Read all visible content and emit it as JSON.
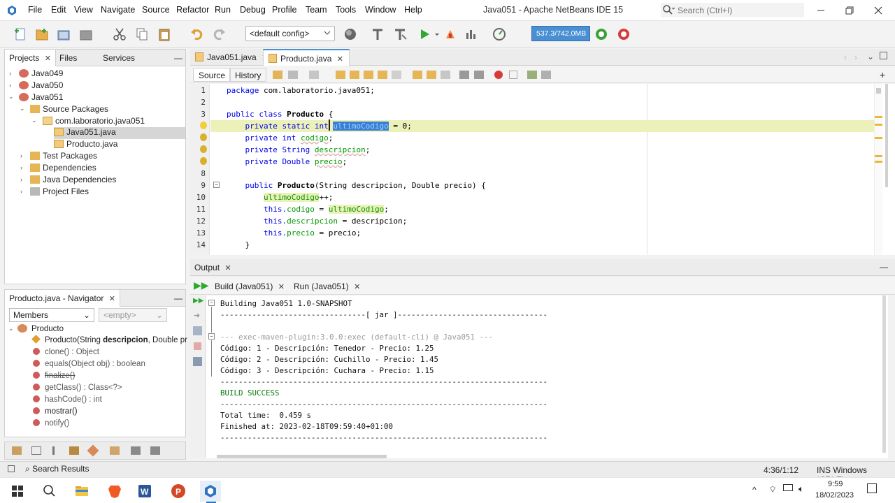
{
  "window": {
    "title": "Java051 - Apache NetBeans IDE 15",
    "search_placeholder": "Search (Ctrl+I)"
  },
  "menu": [
    "File",
    "Edit",
    "View",
    "Navigate",
    "Source",
    "Refactor",
    "Run",
    "Debug",
    "Profile",
    "Team",
    "Tools",
    "Window",
    "Help"
  ],
  "toolbar": {
    "config": "<default config>",
    "memory": "537.3/742.0MB"
  },
  "projects_panel": {
    "tabs": [
      "Projects",
      "Files",
      "Services"
    ],
    "tree": [
      {
        "label": "Java049",
        "level": 0
      },
      {
        "label": "Java050",
        "level": 0
      },
      {
        "label": "Java051",
        "level": 0
      },
      {
        "label": "Source Packages",
        "level": 1
      },
      {
        "label": "com.laboratorio.java051",
        "level": 2
      },
      {
        "label": "Java051.java",
        "level": 3
      },
      {
        "label": "Producto.java",
        "level": 3
      },
      {
        "label": "Test Packages",
        "level": 1
      },
      {
        "label": "Dependencies",
        "level": 1
      },
      {
        "label": "Java Dependencies",
        "level": 1
      },
      {
        "label": "Project Files",
        "level": 1
      }
    ]
  },
  "navigator": {
    "title": "Producto.java - Navigator",
    "filter": "Members",
    "empty": "<empty>",
    "class_name": "Producto",
    "members": [
      {
        "label": "Producto(String ",
        "bold": "descripcion",
        "rest": ", Double pr"
      },
      {
        "label": "clone() : Object",
        "bold": "",
        "rest": ""
      },
      {
        "label": "equals(Object obj) : boolean",
        "bold": "",
        "rest": ""
      },
      {
        "label": "finalize()",
        "bold": "",
        "rest": ""
      },
      {
        "label": "getClass() : Class<?>",
        "bold": "",
        "rest": ""
      },
      {
        "label": "hashCode() : int",
        "bold": "",
        "rest": ""
      },
      {
        "label": "mostrar()",
        "bold": "",
        "rest": ""
      },
      {
        "label": "notify()",
        "bold": "",
        "rest": ""
      }
    ]
  },
  "editor": {
    "tabs": [
      "Java051.java",
      "Producto.java"
    ],
    "subtabs": [
      "Source",
      "History"
    ],
    "line_numbers": [
      "1",
      "2",
      "3",
      "4",
      "5",
      "6",
      "7",
      "8",
      "9",
      "10",
      "11",
      "12",
      "13",
      "14"
    ],
    "code": {
      "l1": "package com.laboratorio.java051;",
      "l3a": "public class ",
      "l3b": "Producto",
      "l3c": " {",
      "l4a": "    private static int ",
      "l4b": "ultimoCodigo",
      "l4c": " = 0;",
      "l5a": "    private int ",
      "l5b": "codigo",
      "l5c": ";",
      "l6a": "    private String ",
      "l6b": "descripcion",
      "l6c": ";",
      "l7a": "    private Double ",
      "l7b": "precio",
      "l7c": ";",
      "l9a": "    public ",
      "l9b": "Producto",
      "l9c": "(String descripcion, Double precio) {",
      "l10a": "        ",
      "l10b": "ultimoCodigo",
      "l10c": "++;",
      "l11a": "        this.",
      "l11b": "codigo",
      "l11c": " = ",
      "l11d": "ultimoCodigo",
      "l11e": ";",
      "l12a": "        this.",
      "l12b": "descripcion",
      "l12c": " = descripcion;",
      "l13a": "        this.",
      "l13b": "precio",
      "l13c": " = precio;",
      "l14": "    }"
    }
  },
  "output": {
    "title": "Output",
    "tabs": [
      "Build (Java051)",
      "Run (Java051)"
    ],
    "lines": [
      "Building Java051 1.0-SNAPSHOT",
      "--------------------------------[ jar ]---------------------------------",
      "",
      "--- exec-maven-plugin:3.0.0:exec (default-cli) @ Java051 ---",
      "Código: 1 - Descripción: Tenedor - Precio: 1.25",
      "Código: 2 - Descripción: Cuchillo - Precio: 1.45",
      "Código: 3 - Descripción: Cuchara - Precio: 1.15",
      "------------------------------------------------------------------------",
      "BUILD SUCCESS",
      "------------------------------------------------------------------------",
      "Total time:  0.459 s",
      "Finished at: 2023-02-18T09:59:40+01:00",
      "------------------------------------------------------------------------"
    ]
  },
  "statusbar": {
    "search_results": "Search Results",
    "position": "4:36/1:12",
    "mode": "INS Windows (CRLF)"
  },
  "taskbar": {
    "time": "9:59",
    "date": "18/02/2023"
  }
}
